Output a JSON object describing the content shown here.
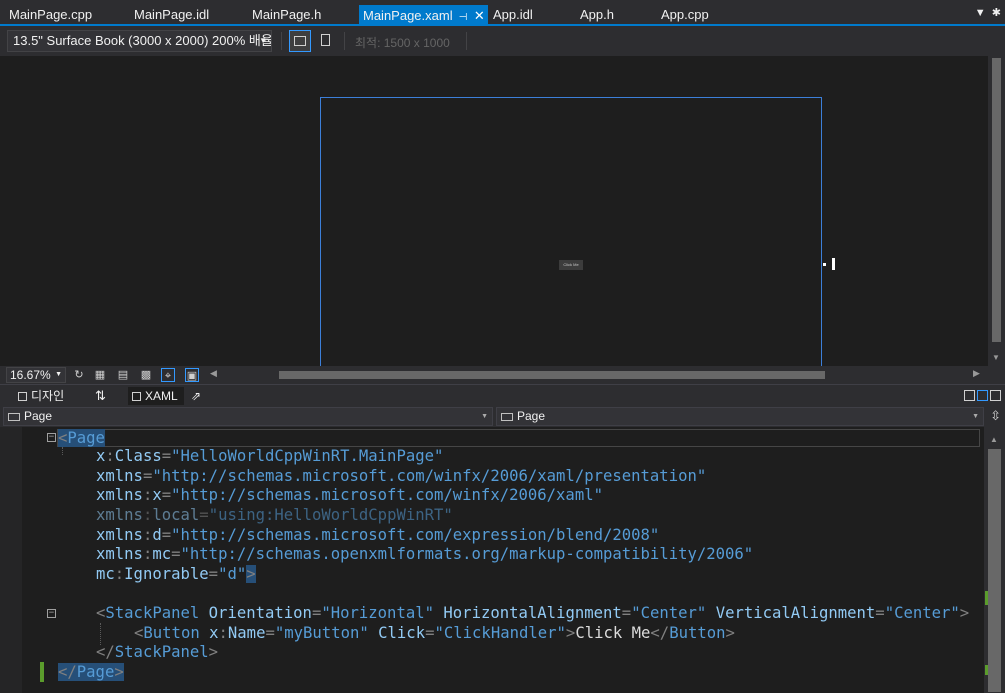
{
  "tabs": [
    {
      "label": "MainPage.cpp",
      "active": false
    },
    {
      "label": "MainPage.idl",
      "active": false
    },
    {
      "label": "MainPage.h",
      "active": false
    },
    {
      "label": "MainPage.xaml",
      "active": true
    },
    {
      "label": "App.idl",
      "active": false
    },
    {
      "label": "App.h",
      "active": false
    },
    {
      "label": "App.cpp",
      "active": false
    }
  ],
  "toolbar": {
    "device": "13.5\" Surface Book (3000 x 2000) 200% 배율",
    "min_size": "최적: 1500 x 1000"
  },
  "canvas": {
    "button_text": "Click Me"
  },
  "zoom": {
    "value": "16.67%"
  },
  "view_tabs": {
    "design": "디자인",
    "xaml": "XAML"
  },
  "nav": {
    "left": "Page",
    "right": "Page"
  },
  "code": {
    "l1_el": "Page",
    "l2_a": "x",
    "l2_b": "Class",
    "l2_v": "\"HelloWorldCppWinRT.MainPage\"",
    "l3_a": "xmlns",
    "l3_v": "\"http://schemas.microsoft.com/winfx/2006/xaml/presentation\"",
    "l4_a": "xmlns",
    "l4_b": "x",
    "l4_v": "\"http://schemas.microsoft.com/winfx/2006/xaml\"",
    "l5_a": "xmlns",
    "l5_b": "local",
    "l5_v": "\"using:HelloWorldCppWinRT\"",
    "l6_a": "xmlns",
    "l6_b": "d",
    "l6_v": "\"http://schemas.microsoft.com/expression/blend/2008\"",
    "l7_a": "xmlns",
    "l7_b": "mc",
    "l7_v": "\"http://schemas.openxmlformats.org/markup-compatibility/2006\"",
    "l8_a": "mc",
    "l8_b": "Ignorable",
    "l8_v": "\"d\"",
    "l10_el": "StackPanel",
    "l10_a1": "Orientation",
    "l10_v1": "\"Horizontal\"",
    "l10_a2": "HorizontalAlignment",
    "l10_v2": "\"Center\"",
    "l10_a3": "VerticalAlignment",
    "l10_v3": "\"Center\"",
    "l11_el": "Button",
    "l11_a1": "x",
    "l11_a1b": "Name",
    "l11_v1": "\"myButton\"",
    "l11_a2": "Click",
    "l11_v2": "\"ClickHandler\"",
    "l11_txt": "Click Me",
    "l11_close": "Button",
    "l12_el": "StackPanel",
    "l13_el": "Page"
  },
  "colors": {
    "accent": "#007acc",
    "editor_bg": "#1e1e1e",
    "chrome_bg": "#2d2d30",
    "attr": "#92caf4",
    "value": "#569cd6",
    "punct": "#808080",
    "change_marker": "#5b9c2c"
  }
}
